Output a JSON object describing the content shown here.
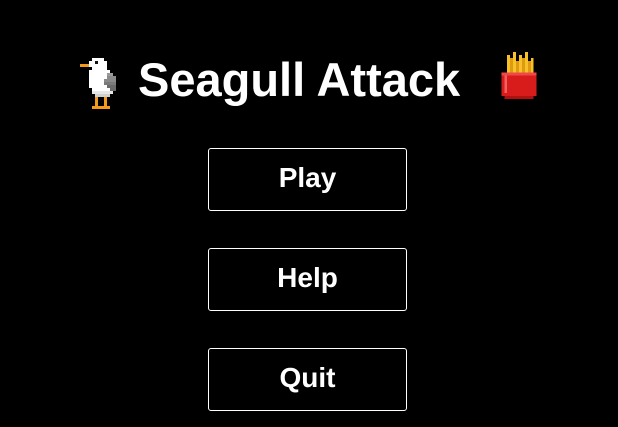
{
  "game": {
    "title": "Seagull Attack",
    "title_icons": [
      "seagull-icon",
      "fries-icon"
    ]
  },
  "menu": {
    "play_label": "Play",
    "help_label": "Help",
    "quit_label": "Quit"
  },
  "colors": {
    "background": "#000000",
    "text": "#ffffff",
    "button_border": "#ffffff",
    "fries_box": "#d81c1c",
    "fries": "#f7c12a"
  }
}
